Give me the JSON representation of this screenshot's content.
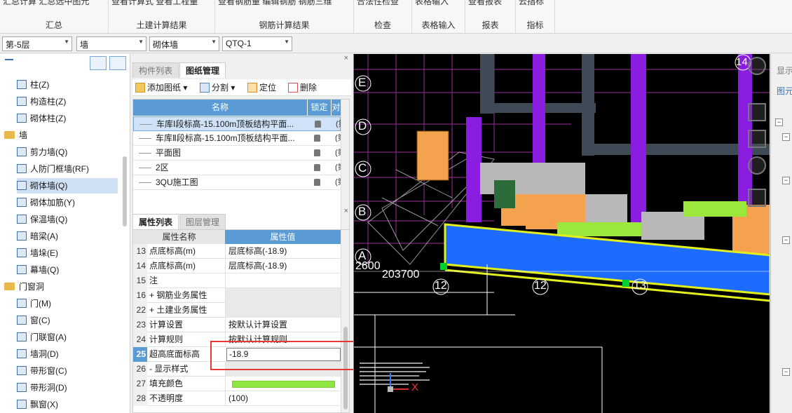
{
  "ribbon": {
    "groups": [
      {
        "label": "汇总",
        "cut_text": "汇总计算  汇总选中图元"
      },
      {
        "label": "土建计算结果",
        "cut_text": "查看计算式  查看工程量"
      },
      {
        "label": "钢筋计算结果",
        "cut_text": "查看钢筋量  编辑钢筋  钢筋三维"
      },
      {
        "label": "检查",
        "cut_text": "合法性检查"
      },
      {
        "label": "表格输入",
        "cut_text": "表格输入"
      },
      {
        "label": "报表",
        "cut_text": "查看报表"
      },
      {
        "label": "指标",
        "cut_text": "云指标"
      }
    ]
  },
  "selectors": {
    "floor": "第-5层",
    "category": "墙",
    "type": "砌体墙",
    "element": "QTQ-1"
  },
  "tree": {
    "items": [
      {
        "label": "柱(Z)",
        "icon": "column-icon",
        "level": 1
      },
      {
        "label": "构造柱(Z)",
        "icon": "constructional-column-icon",
        "level": 1
      },
      {
        "label": "砌体柱(Z)",
        "icon": "masonry-column-icon",
        "level": 1
      },
      {
        "label": "墙",
        "icon": "folder-icon",
        "level": 0
      },
      {
        "label": "剪力墙(Q)",
        "icon": "shear-wall-icon",
        "level": 1
      },
      {
        "label": "人防门框墙(RF)",
        "icon": "civil-defense-door-wall-icon",
        "level": 1
      },
      {
        "label": "砌体墙(Q)",
        "icon": "masonry-wall-icon",
        "level": 1
      },
      {
        "label": "砌体加筋(Y)",
        "icon": "masonry-reinforcement-icon",
        "level": 1
      },
      {
        "label": "保温墙(Q)",
        "icon": "insulation-wall-icon",
        "level": 1
      },
      {
        "label": "暗梁(A)",
        "icon": "hidden-beam-icon",
        "level": 1
      },
      {
        "label": "墙垛(E)",
        "icon": "wall-pier-icon",
        "level": 1
      },
      {
        "label": "幕墙(Q)",
        "icon": "curtain-wall-icon",
        "level": 1
      },
      {
        "label": "门窗洞",
        "icon": "folder-icon",
        "level": 0
      },
      {
        "label": "门(M)",
        "icon": "door-icon",
        "level": 1
      },
      {
        "label": "窗(C)",
        "icon": "window-icon",
        "level": 1
      },
      {
        "label": "门联窗(A)",
        "icon": "door-window-icon",
        "level": 1
      },
      {
        "label": "墙洞(D)",
        "icon": "wall-opening-icon",
        "level": 1
      },
      {
        "label": "带形窗(C)",
        "icon": "strip-window-icon",
        "level": 1
      },
      {
        "label": "带形洞(D)",
        "icon": "strip-opening-icon",
        "level": 1
      },
      {
        "label": "飘窗(X)",
        "icon": "bay-window-icon",
        "level": 1
      }
    ]
  },
  "drawing_panel": {
    "tabs": [
      "构件列表",
      "图纸管理"
    ],
    "toolbar": {
      "add": "添加图纸",
      "split": "分割",
      "locate": "定位",
      "delete": "删除"
    },
    "columns": [
      "名称",
      "锁定",
      "对"
    ],
    "rows": [
      {
        "name": "车库Ⅰ段标高-15.100m顶板结构平面...",
        "lock_col": "(第"
      },
      {
        "name": "车库Ⅱ段标高-15.100m顶板结构平面...",
        "lock_col": "(第"
      },
      {
        "name": "平面图",
        "lock_col": "(第"
      },
      {
        "name": "2区",
        "lock_col": "(第"
      },
      {
        "name": "3QU施工图",
        "lock_col": "(第"
      }
    ]
  },
  "property_panel": {
    "tabs": [
      "属性列表",
      "图层管理"
    ],
    "columns": [
      "属性名称",
      "属性值"
    ],
    "rows": [
      {
        "no": "13",
        "name": "点底标高(m)",
        "value": "层底标高(-18.9)"
      },
      {
        "no": "14",
        "name": "点底标高(m)",
        "value": "层底标高(-18.9)"
      },
      {
        "no": "15",
        "name": "注",
        "value": ""
      },
      {
        "no": "16",
        "name": "+ 钢筋业务属性",
        "value": ""
      },
      {
        "no": "22",
        "name": "+ 土建业务属性",
        "value": ""
      },
      {
        "no": "23",
        "name": "计算设置",
        "value": "按默认计算设置"
      },
      {
        "no": "24",
        "name": "计算规则",
        "value": "按默认计算规则"
      },
      {
        "no": "25",
        "name": "超高底面标高",
        "value": "-18.9"
      },
      {
        "no": "26",
        "name": "- 显示样式",
        "value": ""
      },
      {
        "no": "27",
        "name": "填充颜色",
        "value": ""
      },
      {
        "no": "28",
        "name": "不透明度",
        "value": "(100)"
      }
    ]
  },
  "viewport": {
    "axis_labels": [
      "E",
      "D",
      "C",
      "B",
      "A"
    ],
    "col_labels": [
      "12",
      "12",
      "13"
    ],
    "dims": [
      "2600",
      "203700"
    ],
    "top_label": "14",
    "axis_x": "X",
    "colors": {
      "wall_blue": "#1e6cff",
      "purple": "#8a1de0",
      "orange": "#f4a24e",
      "lime": "#9be83c",
      "grey": "#b8b8b8"
    }
  },
  "right_panel": {
    "title": "显示",
    "sub": "图元"
  }
}
